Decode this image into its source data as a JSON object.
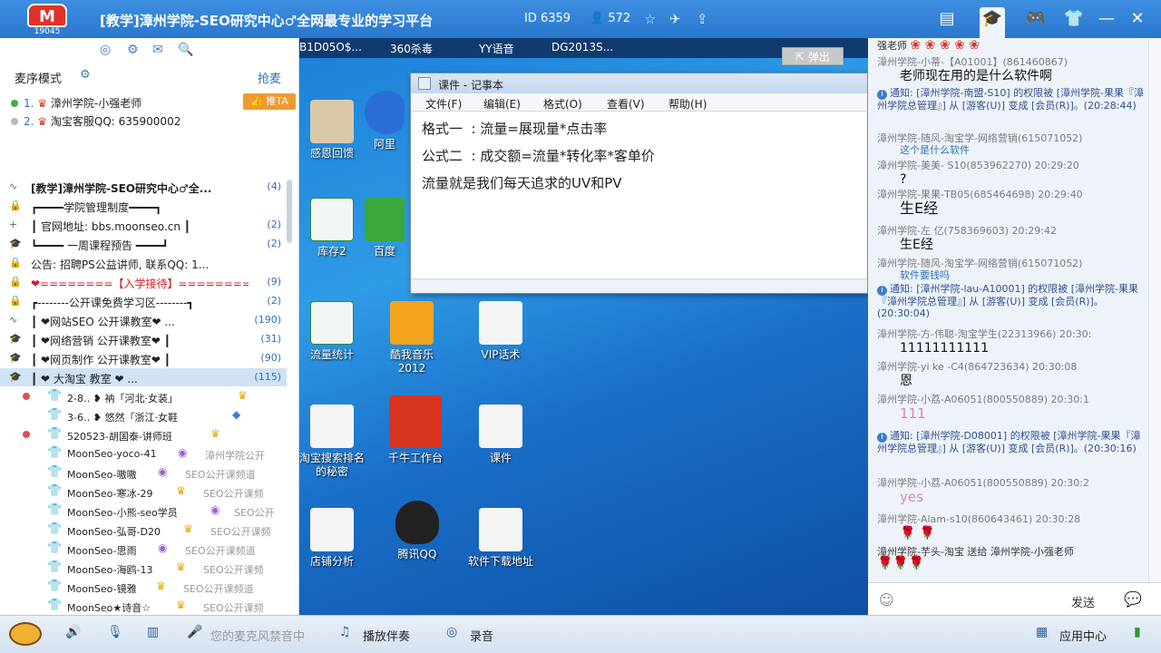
{
  "header": {
    "logo_count": "19045",
    "title": "[教学]漳州学院-SEO研究中心♂全网最专业的学习平台",
    "room_id": "ID 6359",
    "user_count": "572"
  },
  "left": {
    "mode_label": "麦序模式",
    "grab_label": "抢麦",
    "push_label": "推TA",
    "mic_queue": [
      {
        "index": "1.",
        "name": "漳州学院-小强老师"
      },
      {
        "index": "2.",
        "name": "淘宝客服QQ: 635900002"
      }
    ],
    "channels": [
      {
        "text": "[教学]漳州学院-SEO研究中心♂全...",
        "num": "(4)"
      },
      {
        "text": "┏━━━━学院管理制度━━━━┓",
        "num": ""
      },
      {
        "text": "┃  官网地址: bbs.moonseo.cn   ┃",
        "num": "(2)"
      },
      {
        "text": "┗━━━━ 一周课程预告 ━━━━┛",
        "num": "(2)"
      },
      {
        "text": "公告: 招聘PS公益讲师, 联系QQ: 1...",
        "num": ""
      },
      {
        "text": "❤========【入学接待】========❤",
        "num": "(9)"
      },
      {
        "text": "┏--------公开课免费学习区--------┓",
        "num": "(2)"
      },
      {
        "text": "┃      ❤网站SEO  公开课教室❤  ...",
        "num": "(190)"
      },
      {
        "text": "┃      ❤网络营销  公开课教室❤     ┃",
        "num": "(31)"
      },
      {
        "text": "┃      ❤网页制作  公开课教室❤     ┃",
        "num": "(90)"
      },
      {
        "text": "┃      ❤  大淘宝    教室      ❤  ...",
        "num": "(115)"
      }
    ],
    "users": [
      {
        "name": "2-8‥ ❥ 衲「河北·女装」",
        "group": ""
      },
      {
        "name": "3-6‥ ❥ 悠然「浙江·女鞋",
        "group": ""
      },
      {
        "name": "520523-胡国泰-讲师班",
        "group": ""
      },
      {
        "name": "MoonSeo-yoco-41",
        "group": "漳州学院公开"
      },
      {
        "name": "MoonSeo-嗷嗷",
        "group": "SEO公开课频道"
      },
      {
        "name": "MoonSeo-寒冰-29",
        "group": "SEO公开课频"
      },
      {
        "name": "MoonSeo-小熊-seo学员",
        "group": "SEO公开"
      },
      {
        "name": "MoonSeo-弘哥-D20",
        "group": "SEO公开课频"
      },
      {
        "name": "MoonSeo-思雨",
        "group": "SEO公开课频道"
      },
      {
        "name": "MoonSeo-海鸥-13",
        "group": "SEO公开课频"
      },
      {
        "name": "MoonSeo-镜雅",
        "group": "SEO公开课频道"
      },
      {
        "name": "MoonSeo★诗音☆",
        "group": "SEO公开课频"
      }
    ]
  },
  "desktop": {
    "taskbar": [
      "B1D05O$...",
      "360杀毒",
      "YY语音",
      "DG2013S..."
    ],
    "popout_label": "弹出",
    "icons": [
      "感恩回馈",
      "阿里",
      "库存2",
      "百度",
      "流量统计",
      "酷我音乐2012",
      "VIP话术",
      "淘宝搜索排名的秘密",
      "千牛工作台",
      "课件",
      "店铺分析",
      "腾讯QQ",
      "软件下载地址"
    ]
  },
  "notepad": {
    "title": "课件 - 记事本",
    "menu": [
      "文件(F)",
      "编辑(E)",
      "格式(O)",
      "查看(V)",
      "帮助(H)"
    ],
    "lines": [
      "格式一  : 流量=展现量*点击率",
      "公式二  : 成交额=流量*转化率*客单价",
      "流量就是我们每天追求的UV和PV"
    ]
  },
  "chat": {
    "top_nick": "强老师",
    "messages": [
      {
        "nick": "漳州学院-小蒂-【A01001】(861460867)",
        "time": "",
        "body": "老师现在用的是什么软件啊"
      },
      {
        "notice": "通知: [漳州学院-南盟-S10] 的权限被 [漳州学院-果果『漳州学院总管理』] 从 [游客(U)] 变成 [会员(R)]。(20:28:44)"
      },
      {
        "nick": "漳州学院-随风-淘宝学-网络营销(615071052)",
        "time": "",
        "body": "这个是什么软件"
      },
      {
        "nick": "漳州学院-美美- S10(853962270)",
        "time": "20:29:20",
        "body": "?"
      },
      {
        "nick": "漳州学院-果果-TB05(685464698)",
        "time": "20:29:40",
        "body": "生E经"
      },
      {
        "nick": "漳州学院-左     亿(758369603)",
        "time": "20:29:42",
        "body": "生E经"
      },
      {
        "nick": "漳州学院-随风-淘宝学-网络营销(615071052)",
        "time": "",
        "body": "软件要钱吗"
      },
      {
        "notice": "通知: [漳州学院-lau-A10001] 的权限被 [漳州学院-果果『漳州学院总管理』] 从 [游客(U)] 变成 [会员(R)]。(20:30:04)"
      },
      {
        "nick": "漳州学院-方-伟聪-淘宝学生(22313966)",
        "time": "20:30:",
        "body": "11111111111"
      },
      {
        "nick": "漳州学院-yi ke -C4(864723634)",
        "time": "20:30:08",
        "body": "恩"
      },
      {
        "nick": "漳州学院-小荔-A06051(800550889)",
        "time": "20:30:1",
        "body": "111"
      },
      {
        "notice": "通知: [漳州学院-D08001] 的权限被 [漳州学院-果果『漳州学院总管理』] 从 [游客(U)] 变成 [会员(R)]。(20:30:16)"
      },
      {
        "nick": "漳州学院-小荔-A06051(800550889)",
        "time": "20:30:2",
        "body": "yes"
      },
      {
        "nick": "漳州学院-Alam-s10(860643461)",
        "time": "20:30:28",
        "body": ""
      },
      {
        "gift": "漳州学院-芋头-淘宝 送给 漳州学院-小强老师"
      }
    ],
    "send_label": "发送"
  },
  "bottom": {
    "mic_status": "您的麦克风禁音中",
    "accompany": "播放伴奏",
    "record": "录音",
    "app_center": "应用中心"
  }
}
